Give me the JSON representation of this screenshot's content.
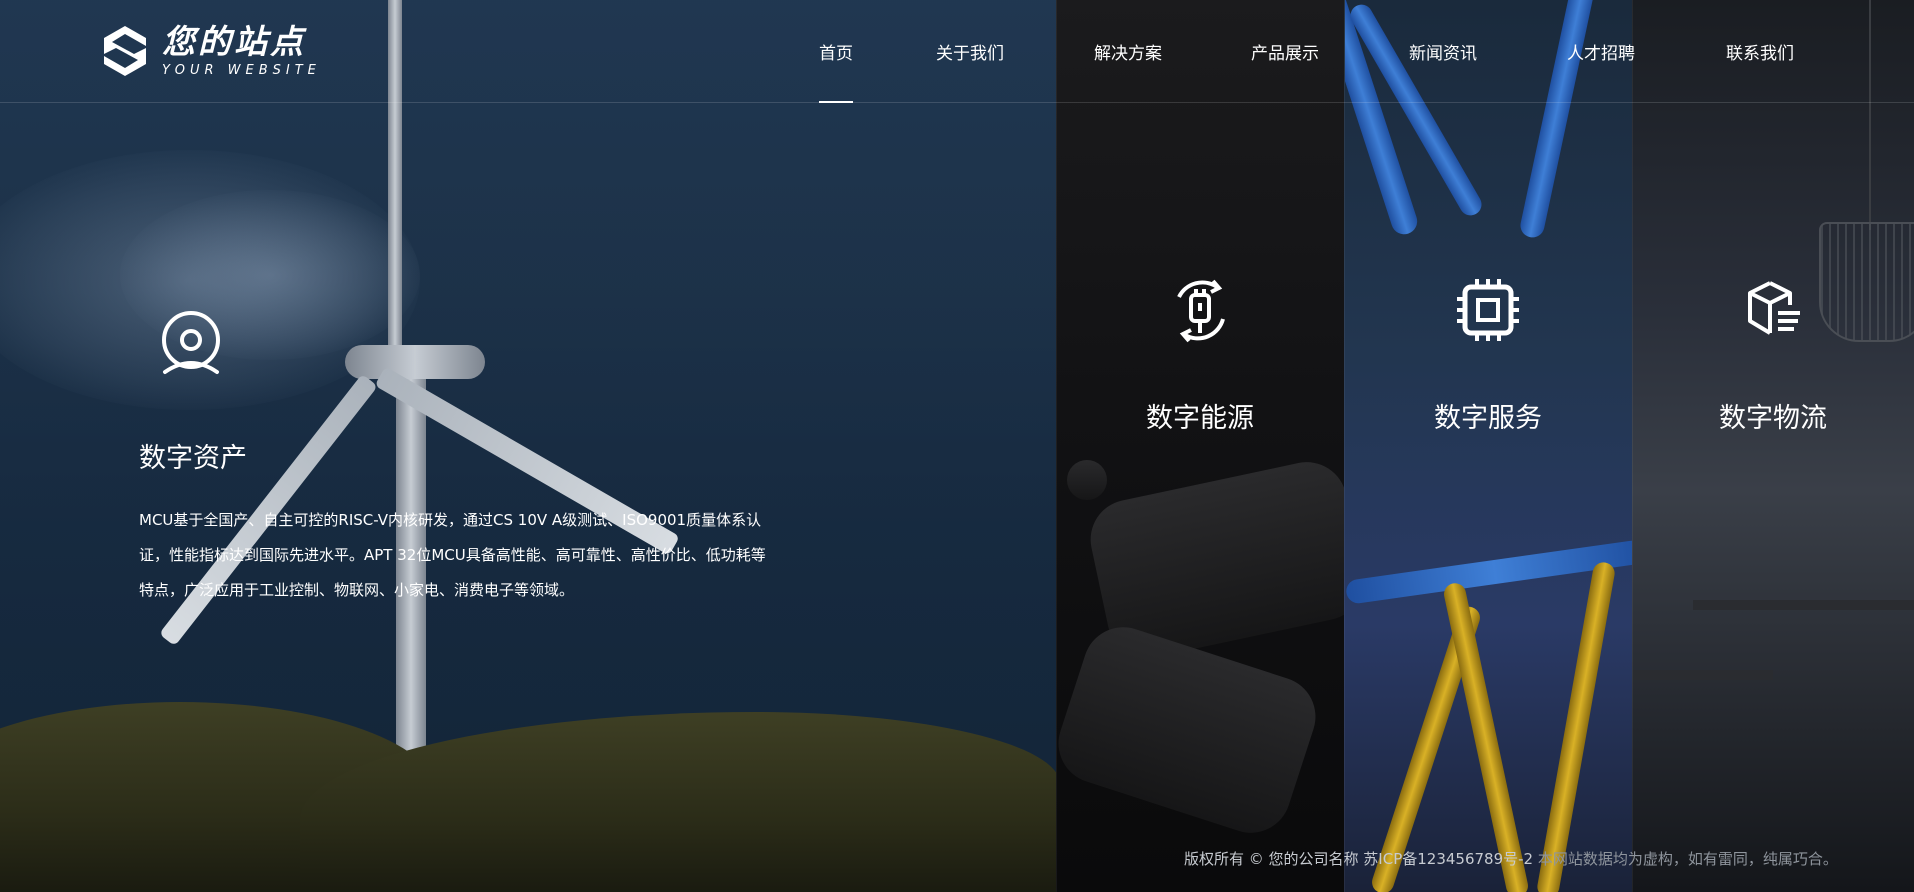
{
  "header": {
    "logo": {
      "title": "您的站点",
      "subtitle": "YOUR WEBSITE"
    },
    "nav": [
      {
        "label": "首页",
        "active": true
      },
      {
        "label": "关于我们",
        "active": false
      },
      {
        "label": "解决方案",
        "active": false
      },
      {
        "label": "产品展示",
        "active": false
      },
      {
        "label": "新闻资讯",
        "active": false
      },
      {
        "label": "人才招聘",
        "active": false
      },
      {
        "label": "联系我们",
        "active": false
      }
    ]
  },
  "panels": {
    "main": {
      "icon": "webcam-icon",
      "title": "数字资产",
      "description": "MCU基于全国产、自主可控的RISC-V内核研发，通过CS 10V A级测试、ISO9001质量体系认证，性能指标达到国际先进水平。APT 32位MCU具备高性能、高可靠性、高性价比、低功耗等特点，广泛应用于工业控制、物联网、小家电、消费电子等领域。"
    },
    "energy": {
      "icon": "energy-cycle-icon",
      "title": "数字能源"
    },
    "service": {
      "icon": "chip-icon",
      "title": "数字服务"
    },
    "logistics": {
      "icon": "cube-logistics-icon",
      "title": "数字物流"
    }
  },
  "footer": {
    "copyright": "版权所有 © 您的公司名称 苏ICP备123456789号-2",
    "note": " 本网站数据均为虚构，如有雷同，纯属巧合。"
  },
  "colors": {
    "text": "#ffffff",
    "footer_copy": "#c7cbd1",
    "footer_note": "#8f959d"
  }
}
